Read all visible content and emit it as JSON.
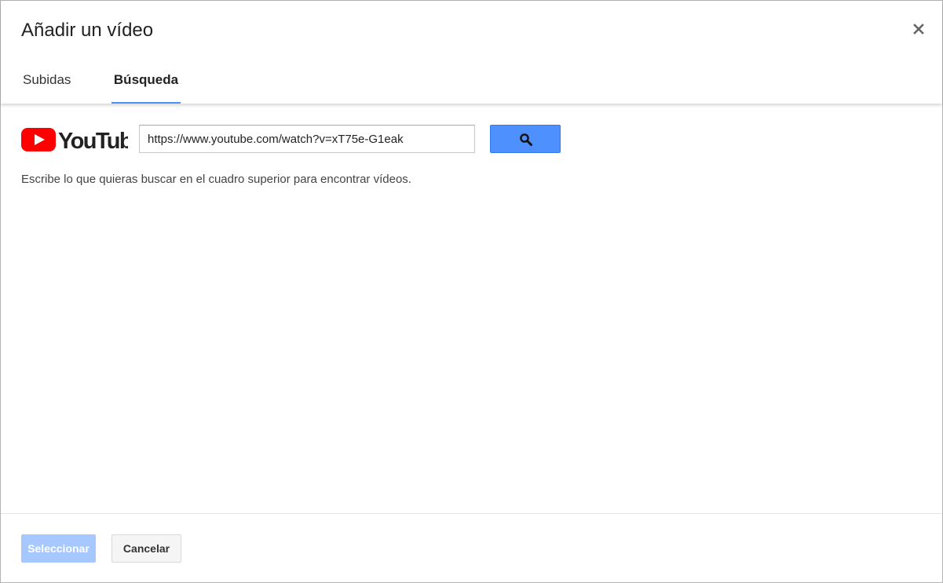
{
  "dialog": {
    "title": "Añadir un vídeo",
    "close_icon": "close-icon"
  },
  "tabs": [
    {
      "label": "Subidas",
      "active": false
    },
    {
      "label": "Búsqueda",
      "active": true
    }
  ],
  "search": {
    "logo": "YouTube",
    "value": "https://www.youtube.com/watch?v=xT75e-G1eak",
    "button_icon": "search-icon",
    "hint": "Escribe lo que quieras buscar en el cuadro superior para encontrar vídeos."
  },
  "footer": {
    "select_label": "Seleccionar",
    "cancel_label": "Cancelar"
  },
  "colors": {
    "accent": "#4d90fe",
    "youtube_red": "#ff0000",
    "disabled_button": "#a6c8ff"
  }
}
